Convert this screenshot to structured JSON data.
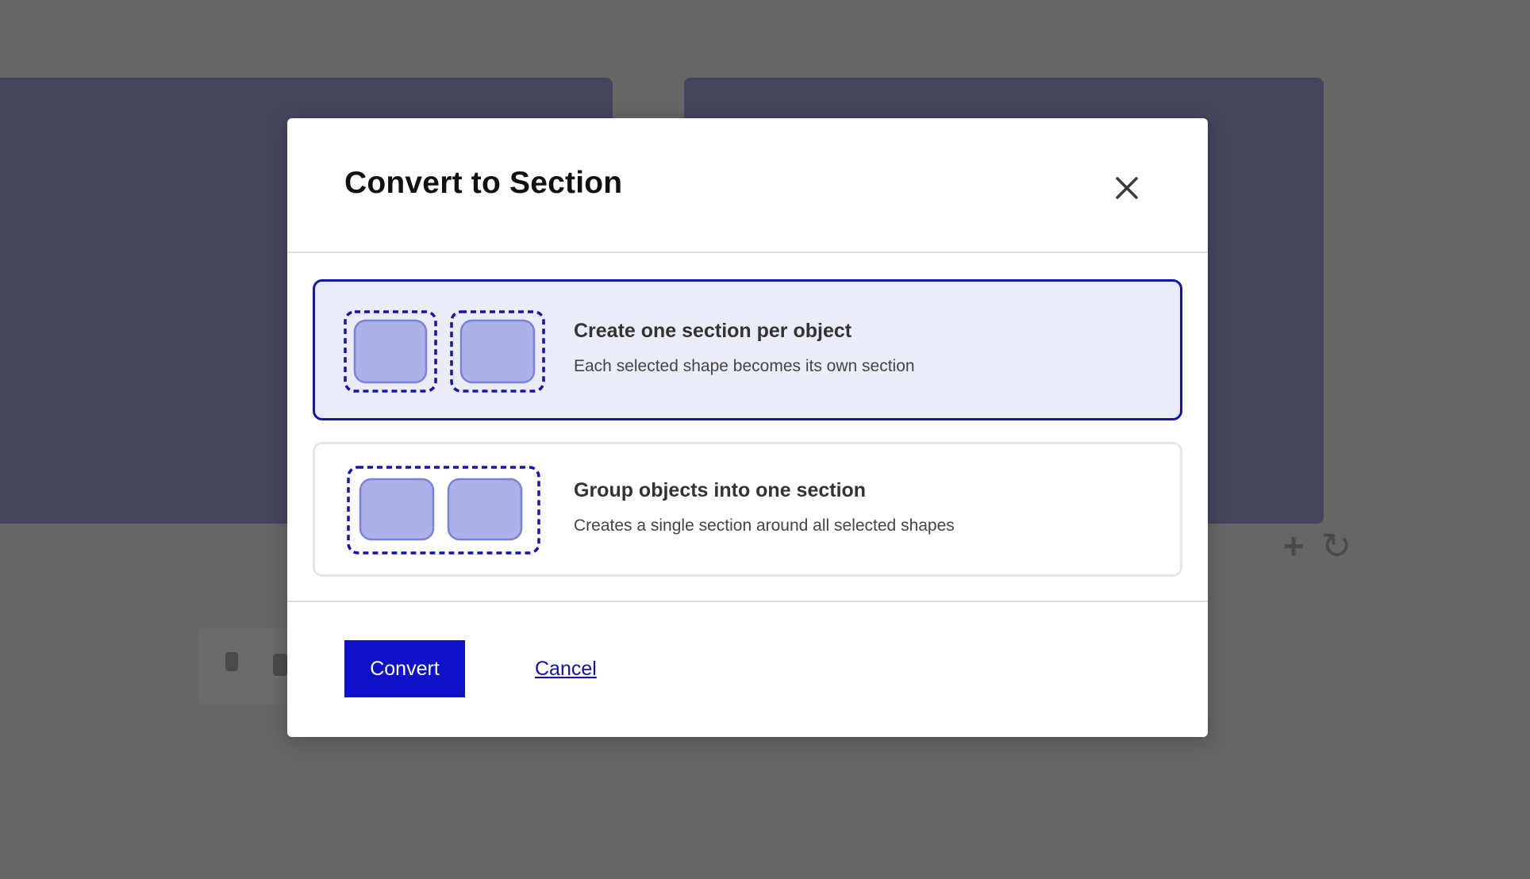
{
  "modal": {
    "title": "Convert to Section",
    "close_icon": "close-icon"
  },
  "options": [
    {
      "title": "Create one section per object",
      "description": "Each selected shape becomes its own section",
      "selected": true,
      "illustration_icon": "separate-sections-icon"
    },
    {
      "title": "Group objects into one section",
      "description": "Creates a single section around all selected shapes",
      "selected": false,
      "illustration_icon": "grouped-section-icon"
    }
  ],
  "footer": {
    "convert_label": "Convert",
    "cancel_label": "Cancel"
  },
  "colors": {
    "primary": "#0f12c8",
    "selected_border": "#1414b0",
    "selected_background": "#eaecf7",
    "shape_fill": "#adb1e8",
    "shape_stroke": "#7b80d9",
    "overlay": "#666666"
  }
}
